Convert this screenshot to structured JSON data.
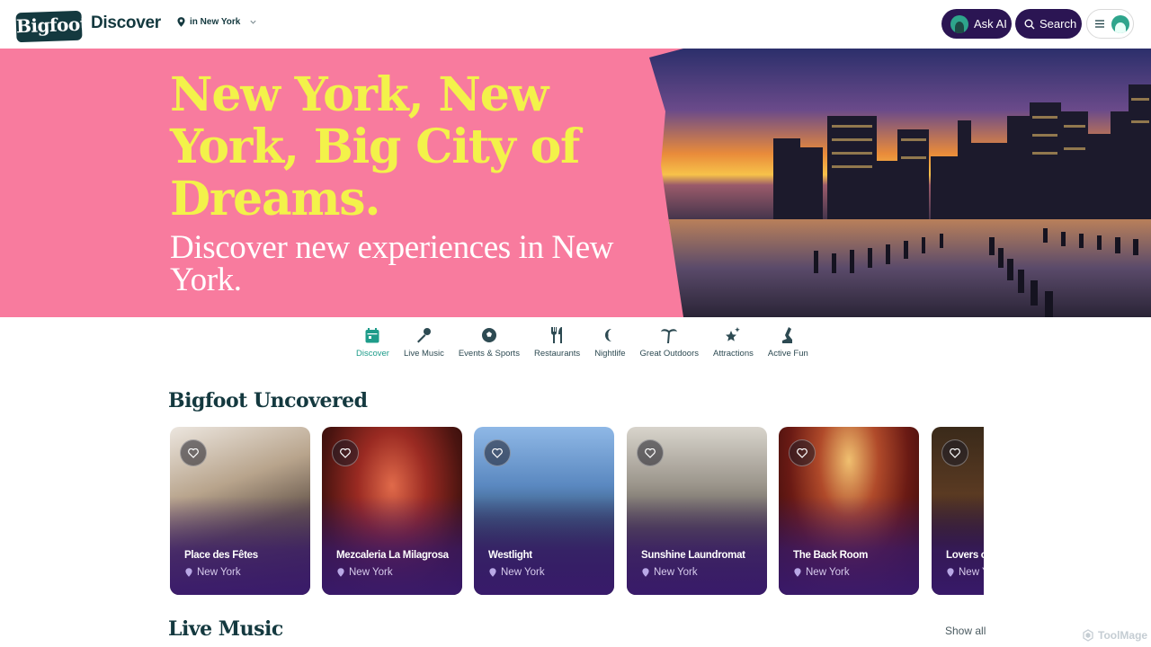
{
  "header": {
    "logo": "Bigfoot",
    "product": "Discover",
    "location": "in New York",
    "ask_ai": "Ask AI",
    "search": "Search"
  },
  "hero": {
    "title": "New York, New York, Big City of Dreams.",
    "subtitle": "Discover new experiences in New York."
  },
  "categories": [
    {
      "label": "Discover",
      "icon": "calendar-icon",
      "active": true
    },
    {
      "label": "Live Music",
      "icon": "microphone-icon",
      "active": false
    },
    {
      "label": "Events & Sports",
      "icon": "soccer-ball-icon",
      "active": false
    },
    {
      "label": "Restaurants",
      "icon": "fork-knife-icon",
      "active": false
    },
    {
      "label": "Nightlife",
      "icon": "moon-icon",
      "active": false
    },
    {
      "label": "Great Outdoors",
      "icon": "palm-tree-icon",
      "active": false
    },
    {
      "label": "Attractions",
      "icon": "sparkle-star-icon",
      "active": false
    },
    {
      "label": "Active Fun",
      "icon": "activity-icon",
      "active": false
    }
  ],
  "sections": {
    "uncovered_title": "Bigfoot Uncovered",
    "live_music_title": "Live Music",
    "show_all": "Show all"
  },
  "cards": [
    {
      "name": "Place des Fêtes",
      "city": "New York"
    },
    {
      "name": "Mezcaleria La Milagrosa",
      "city": "New York"
    },
    {
      "name": "Westlight",
      "city": "New York"
    },
    {
      "name": "Sunshine Laundromat",
      "city": "New York"
    },
    {
      "name": "The Back Room",
      "city": "New York"
    },
    {
      "name": "Lovers of",
      "city": "New York"
    }
  ],
  "watermark": "ToolMage",
  "colors": {
    "brand_dark": "#14393f",
    "hero_pink": "#f87b9e",
    "hero_yellow": "#f3f24a",
    "button_purple": "#2b1553",
    "accent_teal": "#1e9c8a"
  }
}
